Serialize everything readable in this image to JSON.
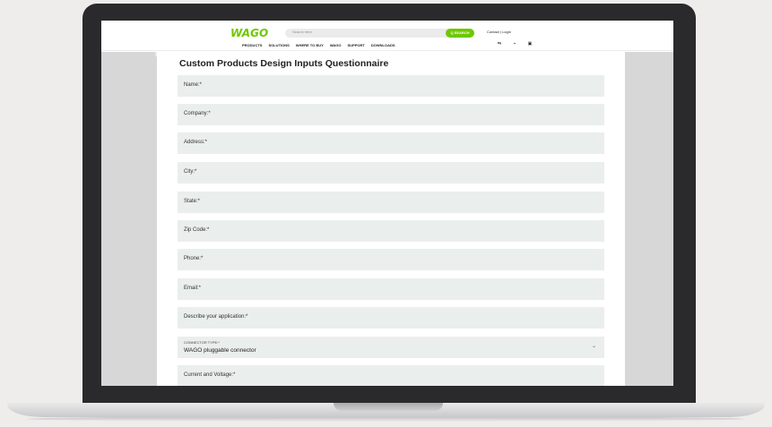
{
  "header": {
    "logo": "WAGO",
    "search_placeholder": "Search here",
    "search_button": "Q SEARCH",
    "top_links": "Contact | Login",
    "nav": [
      "PRODUCTS",
      "SOLUTIONS",
      "WHERE TO BUY",
      "WAGO",
      "SUPPORT",
      "DOWNLOADS"
    ],
    "tools": [
      "compare-icon",
      "share-icon",
      "cart-icon"
    ]
  },
  "form": {
    "title": "Custom Products Design Inputs Questionnaire",
    "fields": [
      {
        "label": "Name:*"
      },
      {
        "label": "Company:*"
      },
      {
        "label": "Address:*"
      },
      {
        "label": "City:*"
      },
      {
        "label": "State:*"
      },
      {
        "label": "Zip Code:*"
      },
      {
        "label": "Phone:*"
      },
      {
        "label": "Email:*"
      },
      {
        "label": "Describe your application:*"
      },
      {
        "label": "CONNECTOR TYPE:*",
        "value": "WAGO pluggable connector",
        "type": "select"
      },
      {
        "label": "Current and Voltage:*"
      }
    ]
  },
  "colors": {
    "brand": "#6ec800",
    "field_bg": "#eaeeec",
    "laptop_bezel": "#2a2a2c"
  }
}
